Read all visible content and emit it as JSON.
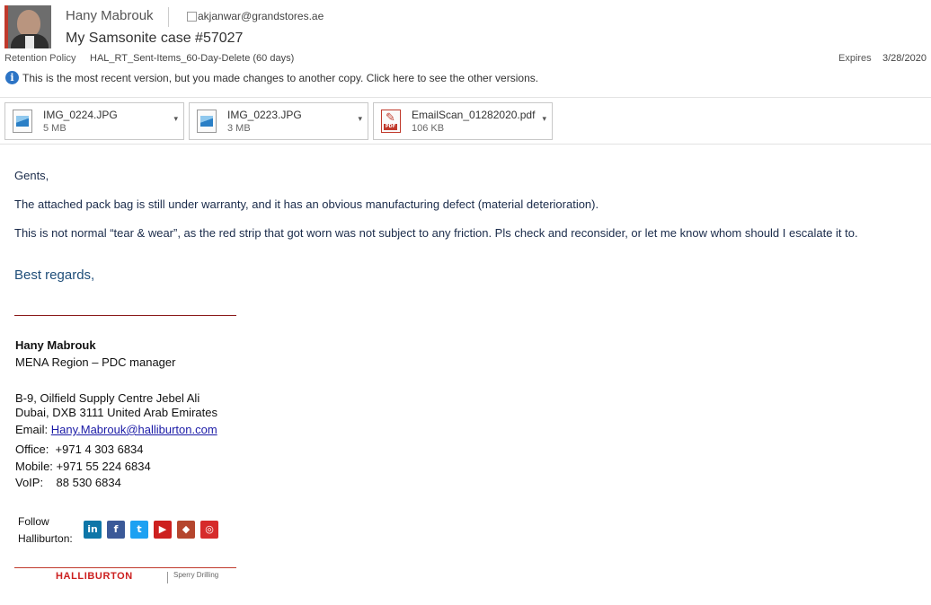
{
  "header": {
    "sender": "Hany Mabrouk",
    "to": "akjanwar@grandstores.ae",
    "subject": "My Samsonite case #57027",
    "retention_label": "Retention Policy",
    "retention_value": "HAL_RT_Sent-Items_60-Day-Delete (60 days)",
    "expires_label": "Expires",
    "expires_value": "3/28/2020",
    "info": "This is the most recent version, but you made changes to another copy. Click here to see the other versions."
  },
  "attachments": [
    {
      "name": "IMG_0224.JPG",
      "size": "5 MB",
      "icon": "image-file-icon"
    },
    {
      "name": "IMG_0223.JPG",
      "size": "3 MB",
      "icon": "image-file-icon"
    },
    {
      "name": "EmailScan_01282020.pdf",
      "size": "106 KB",
      "icon": "pdf-file-icon",
      "icon_tag": "PDF"
    }
  ],
  "body": {
    "greeting": "Gents,",
    "para1": "The attached pack bag is still under warranty, and it has an obvious manufacturing defect (material deterioration).",
    "para2": "This is not normal “tear & wear”, as the red strip that got worn was not subject to any friction. Pls check and reconsider, or let me know whom should I escalate it to.",
    "closing": "Best regards,"
  },
  "signature": {
    "name": "Hany Mabrouk",
    "title": "MENA Region – PDC manager",
    "address1": "B-9, Oilfield Supply Centre Jebel Ali",
    "address2": "Dubai, DXB 3111 United Arab Emirates",
    "email_label": "Email:",
    "email": "Hany.Mabrouk@halliburton.com",
    "office": "Office:  +971 4 303 6834",
    "mobile": "Mobile: +971 55 224 6834",
    "voip": "VoIP:    88 530 6834",
    "follow_line1": "Follow",
    "follow_line2": "Halliburton:",
    "social": [
      {
        "glyph": "in",
        "icon": "linkedin-icon",
        "color": "#0e76a8"
      },
      {
        "glyph": "f",
        "icon": "facebook-icon",
        "color": "#3b5998"
      },
      {
        "glyph": "t",
        "icon": "twitter-icon",
        "color": "#1da1f2"
      },
      {
        "glyph": "▶",
        "icon": "youtube-icon",
        "color": "#cd201f"
      },
      {
        "glyph": "◆",
        "icon": "halliburton-blog-icon",
        "color": "#b5462e"
      },
      {
        "glyph": "◎",
        "icon": "weibo-icon",
        "color": "#d62b2b"
      }
    ],
    "logo_text": "HALLIBURTON",
    "logo_sub": "Sperry Drilling"
  },
  "colors": {
    "body_text": "#1a2b4a",
    "link": "#1a1aa6",
    "brand_red": "#cc1f1f",
    "info_blue": "#2c74c5"
  }
}
